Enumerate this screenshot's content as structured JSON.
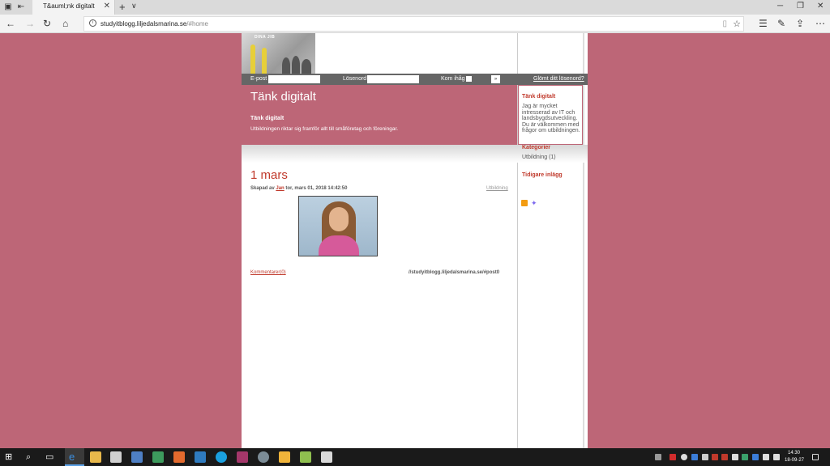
{
  "browser": {
    "tab_title": "T&auml;nk digitalt",
    "url_host": "studyitblogg.liljedalsmarina.se",
    "url_path": "/#home"
  },
  "header": {
    "brand": "DINA JIB"
  },
  "login": {
    "email_label": "E-post",
    "password_label": "Lösenord",
    "remember_label": "Kom ihåg",
    "submit_label": "»",
    "forgot_label": "Glömt ditt lösenord?"
  },
  "banner": {
    "title": "Tänk digitalt",
    "subtitle": "Tänk digitalt",
    "description": "Utbildningen riktar sig framför allt till småföretag och föreningar."
  },
  "sidebar": {
    "about_title": "Tänk digitalt",
    "about_text": "Jag är mycket intresserad av IT och landsbygdsutveckling. Du är välkommen med frågor om utbildningen.",
    "categories_title": "Kategorier",
    "category_item": "Utbildning (1)",
    "archive_title": "Tidigare inlägg"
  },
  "post": {
    "title": "1 mars",
    "meta_prefix": "Skapad av ",
    "author": "Jan",
    "meta_date": " tor, mars 01, 2018 14:42:50",
    "category": "Utbildning",
    "comments": "Kommentarer(0)",
    "permalink": "//studyitblogg.liljedalsmarina.se/#post0"
  },
  "taskbar": {
    "time": "14:30",
    "date": "18-09-27"
  },
  "colors": {
    "background": "#bd6677",
    "accent": "#c0392b",
    "loginbar": "#666666"
  }
}
